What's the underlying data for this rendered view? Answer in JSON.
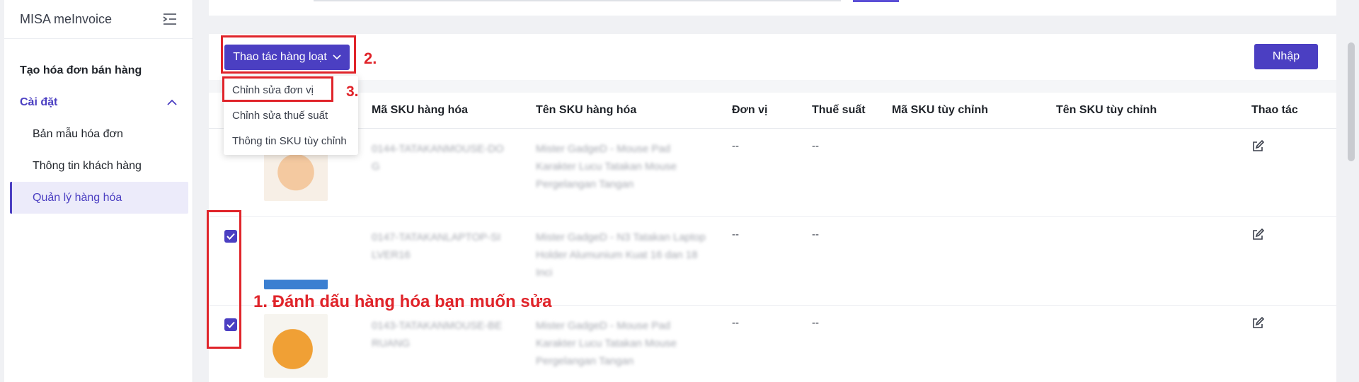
{
  "sidebar": {
    "app_title": "MISA meInvoice",
    "items": [
      {
        "label": "Tạo hóa đơn bán hàng"
      },
      {
        "label": "Cài đặt"
      },
      {
        "label": "Bản mẫu hóa đơn"
      },
      {
        "label": "Thông tin khách hàng"
      },
      {
        "label": "Quản lý hàng hóa"
      }
    ]
  },
  "toolbar": {
    "bulk_label": "Thao tác hàng loạt",
    "import_label": "Nhập"
  },
  "bulk_menu": {
    "items": [
      "Chỉnh sửa đơn vị",
      "Chỉnh sửa thuế suất",
      "Thông tin SKU tùy chỉnh"
    ]
  },
  "table": {
    "headers": [
      "Mã SKU hàng hóa",
      "Tên SKU hàng hóa",
      "Đơn vị",
      "Thuế suất",
      "Mã SKU tùy chỉnh",
      "Tên SKU tùy chỉnh",
      "Thao tác"
    ],
    "rows": [
      {
        "sku": "0144-TATAKANMOUSE-DOG",
        "name": "Mister GadgeD - Mouse Pad Karakter Lucu Tatakan Mouse Pergelangan Tangan",
        "unit": "--",
        "tax": "--"
      },
      {
        "sku": "0147-TATAKANLAPTOP-SILVER16",
        "name": "Mister GadgeD - N3 Tatakan Laptop Holder Alumunium Kuat 16 dan 18 Inci",
        "unit": "--",
        "tax": "--"
      },
      {
        "sku": "0143-TATAKANMOUSE-BERUANG",
        "name": "Mister GadgeD - Mouse Pad Karakter Lucu Tatakan Mouse Pergelangan Tangan",
        "unit": "--",
        "tax": "--"
      }
    ]
  },
  "annotations": {
    "step1": "1. Đánh dấu hàng hóa bạn muốn sửa",
    "step2": "2.",
    "step3": "3."
  },
  "colors": {
    "accent": "#4b3fc2",
    "annotation": "#e0242a"
  }
}
